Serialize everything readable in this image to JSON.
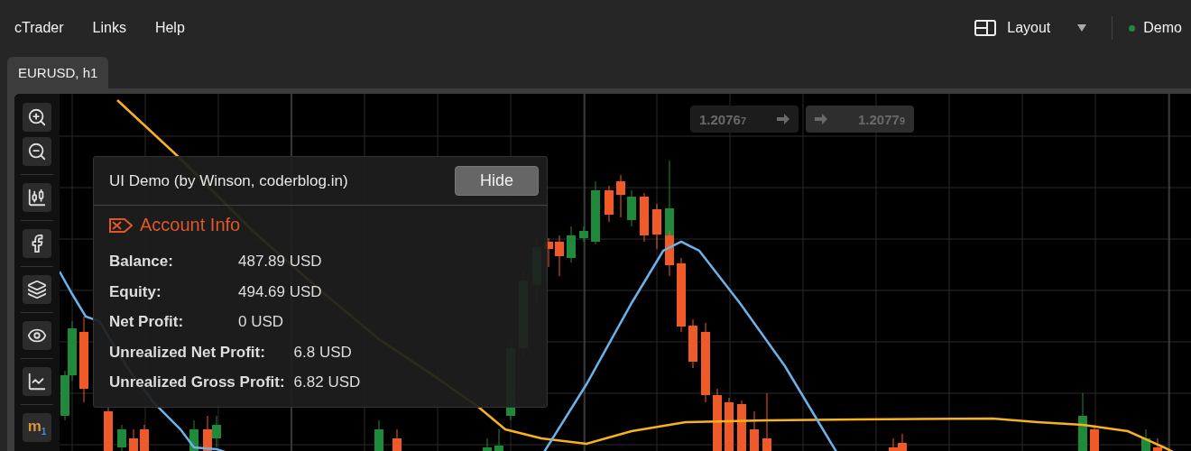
{
  "menu": [
    {
      "label": "cTrader"
    },
    {
      "label": "Links"
    },
    {
      "label": "Help"
    }
  ],
  "layout_button": {
    "label": "Layout"
  },
  "account": {
    "label": "Demo"
  },
  "tabs": [
    {
      "label": "EURUSD, h1",
      "selected": true
    }
  ],
  "toolbar": [
    {
      "kind": "zoom-in"
    },
    {
      "kind": "zoom-out"
    },
    {
      "kind": "separator"
    },
    {
      "kind": "candles"
    },
    {
      "kind": "separator"
    },
    {
      "kind": "facebook"
    },
    {
      "kind": "separator"
    },
    {
      "kind": "layers"
    },
    {
      "kind": "separator"
    },
    {
      "kind": "eye"
    },
    {
      "kind": "separator"
    },
    {
      "kind": "chart-settings"
    },
    {
      "kind": "separator"
    },
    {
      "kind": "timeframe",
      "label": "m$_{1}$"
    }
  ],
  "quotes": {
    "sell": "1.2076$_{7}$",
    "buy": "1.2077$_{9}$"
  },
  "panel": {
    "title": "UI Demo (by Winson, coderblog.in)",
    "hide_button": "Hide",
    "section_title": "Account Info",
    "groups": [
      {
        "kind": "fixed",
        "rows": [
          {
            "label": "Balance:",
            "value": "487.89 USD"
          },
          {
            "label": "Equity:",
            "value": "494.69 USD"
          },
          {
            "label": "Net Profit:",
            "value": "0 USD"
          }
        ]
      },
      {
        "kind": "auto",
        "rows": [
          {
            "label": "Unrealized Net Profit:",
            "value": "6.8 USD"
          },
          {
            "label": "Unrealized Gross Profit:",
            "value": "6.82 USD"
          }
        ]
      }
    ]
  }
}
